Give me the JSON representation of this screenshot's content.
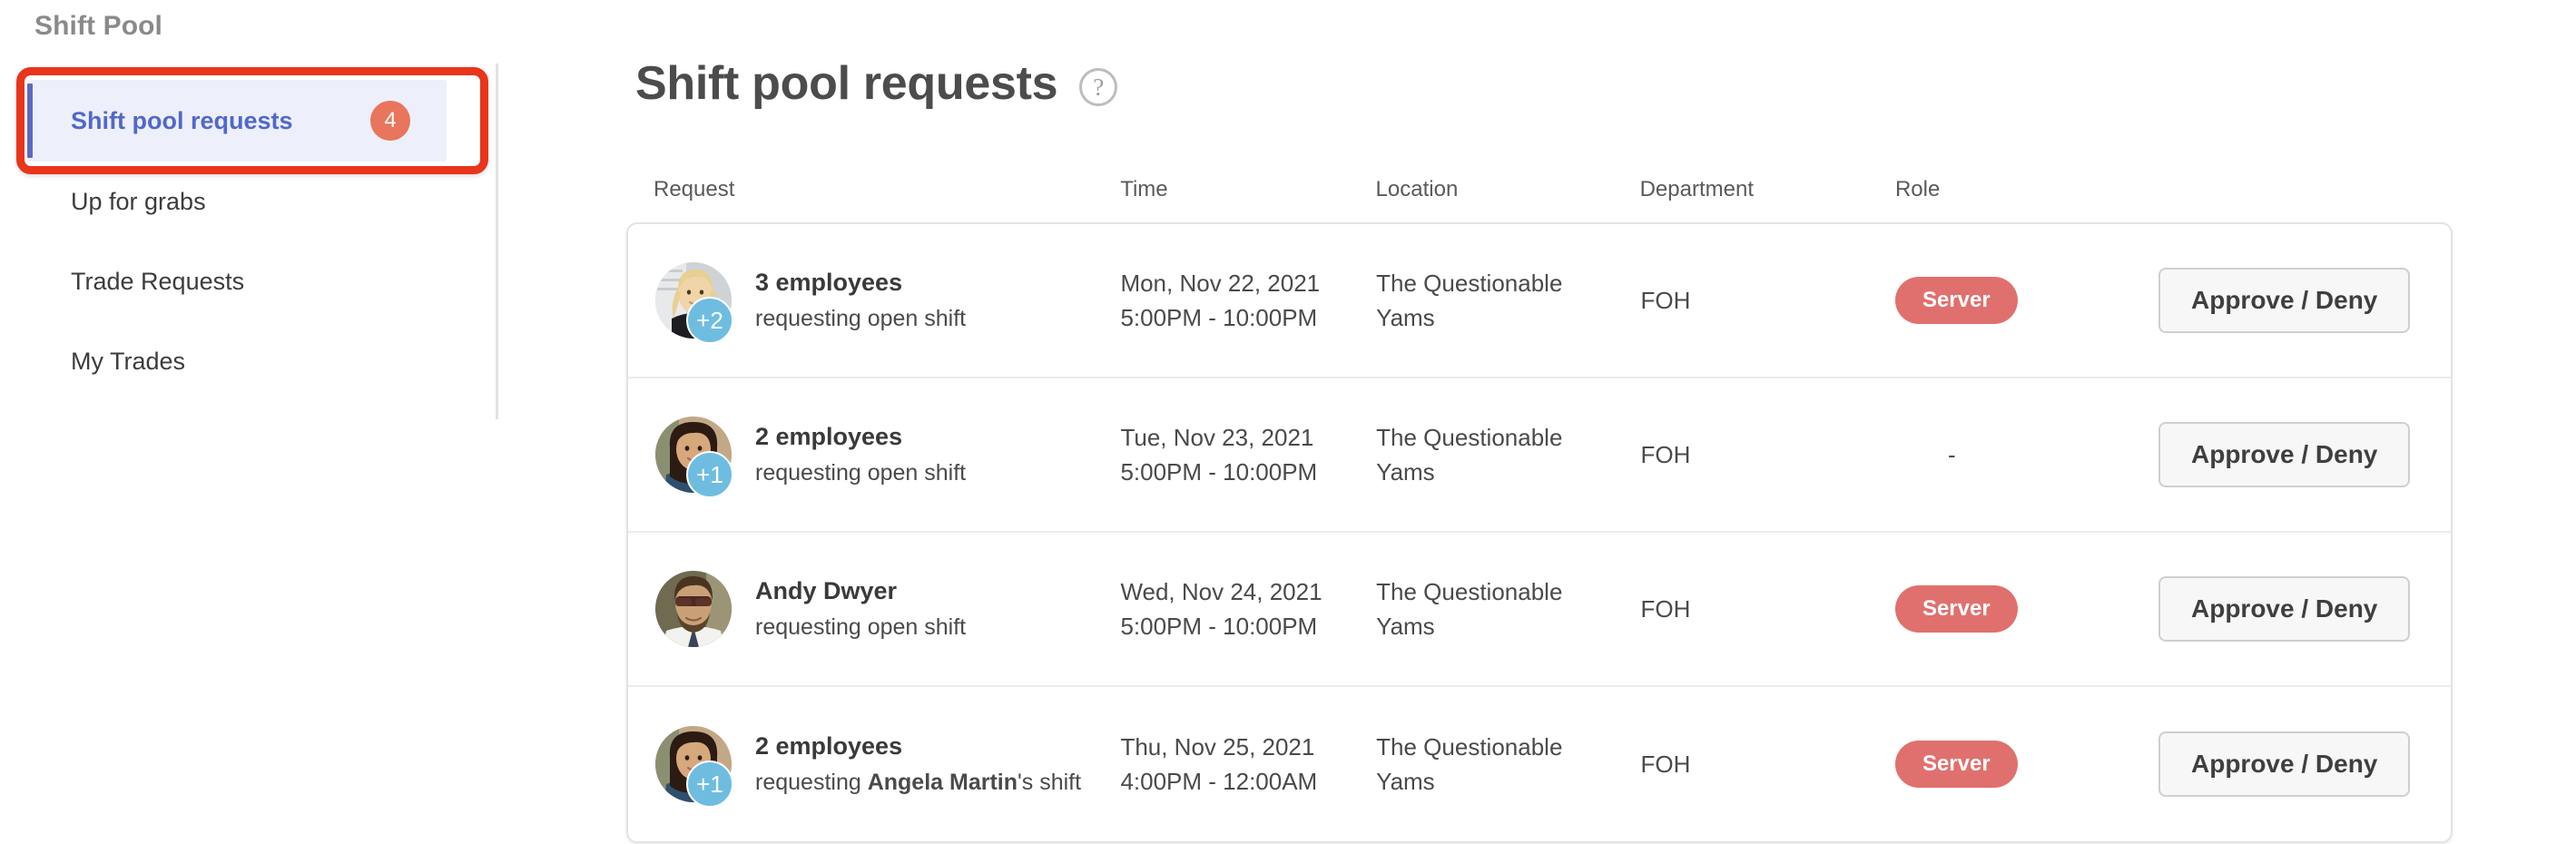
{
  "sidebar": {
    "title": "Shift Pool",
    "items": [
      {
        "label": "Shift pool requests",
        "badge": "4",
        "active": true
      },
      {
        "label": "Up for grabs",
        "badge": "",
        "active": false
      },
      {
        "label": "Trade Requests",
        "badge": "",
        "active": false
      },
      {
        "label": "My Trades",
        "badge": "",
        "active": false
      }
    ]
  },
  "main": {
    "title": "Shift pool requests",
    "help_icon": "help-circle-icon"
  },
  "table": {
    "columns": [
      "Request",
      "Time",
      "Location",
      "Department",
      "Role"
    ],
    "rows": [
      {
        "avatar": "blonde-woman-avatar",
        "avatar_count": "+2",
        "primary": "3 employees",
        "secondary_prefix": "requesting ",
        "secondary_bold": "",
        "secondary_suffix": "open shift",
        "time": "Mon, Nov 22, 2021 5:00PM - 10:00PM",
        "location": "The Questionable Yams",
        "department": "FOH",
        "role": "Server",
        "action": "Approve / Deny"
      },
      {
        "avatar": "dark-haired-woman-avatar",
        "avatar_count": "+1",
        "primary": "2 employees",
        "secondary_prefix": "requesting ",
        "secondary_bold": "",
        "secondary_suffix": "open shift",
        "time": "Tue, Nov 23, 2021 5:00PM - 10:00PM",
        "location": "The Questionable Yams",
        "department": "FOH",
        "role": "-",
        "action": "Approve / Deny"
      },
      {
        "avatar": "man-sunglasses-avatar",
        "avatar_count": "",
        "primary": "Andy Dwyer",
        "secondary_prefix": "requesting ",
        "secondary_bold": "",
        "secondary_suffix": "open shift",
        "time": "Wed, Nov 24, 2021 5:00PM - 10:00PM",
        "location": "The Questionable Yams",
        "department": "FOH",
        "role": "Server",
        "action": "Approve / Deny"
      },
      {
        "avatar": "dark-haired-woman-avatar",
        "avatar_count": "+1",
        "primary": "2 employees",
        "secondary_prefix": "requesting ",
        "secondary_bold": "Angela Martin",
        "secondary_suffix": "'s shift",
        "time": "Thu, Nov 25, 2021 4:00PM - 12:00AM",
        "location": "The Questionable Yams",
        "department": "FOH",
        "role": "Server",
        "action": "Approve / Deny"
      }
    ]
  },
  "colors": {
    "accent_blue": "#5268c9",
    "badge_orange": "#e8755c",
    "role_red": "#e0706e",
    "avatar_count_blue": "#6ebde0",
    "annotation_red": "#e8351b",
    "nav_active_bg": "#edf0fb"
  }
}
